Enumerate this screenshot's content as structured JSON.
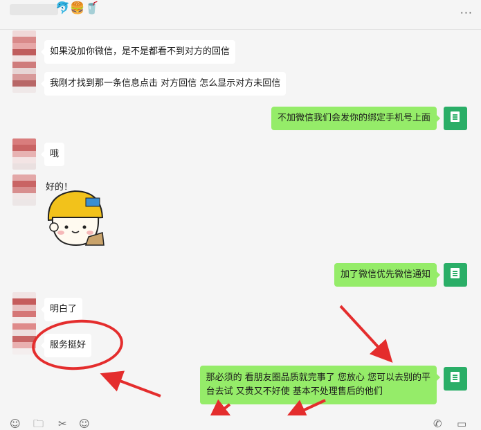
{
  "header": {
    "title_emojis": "🐬🍔🥤",
    "more": "···"
  },
  "messages": [
    {
      "side": "left",
      "text": "如果没加你微信，是不是都看不到对方的回信"
    },
    {
      "side": "left",
      "text": "我刚才找到那一条信息点击 对方回信 怎么显示对方未回信"
    },
    {
      "side": "right",
      "text": "不加微信我们会发你的绑定手机号上面"
    },
    {
      "side": "left",
      "text": "哦"
    },
    {
      "side": "left",
      "type": "sticker",
      "text": "好的！"
    },
    {
      "side": "right",
      "text": "加了微信优先微信通知"
    },
    {
      "side": "left",
      "text": "明白了"
    },
    {
      "side": "left",
      "text": "服务挺好"
    },
    {
      "side": "right",
      "text_line1": "那必须的 看朋友圈品质就完事了 您放心 您可以去别的平",
      "text_line2": "台去试 又贵又不好使 基本不处理售后的他们"
    }
  ],
  "toolbar": {
    "emoji": "☺",
    "folder": "🗀",
    "scissors": "✂",
    "chat": "☺",
    "phone": "✆",
    "video": "▭"
  },
  "colors": {
    "bubble_right": "#95ec69",
    "bubble_left": "#ffffff",
    "annotation": "#e42d2d",
    "avatar_green": "#2aae67"
  }
}
